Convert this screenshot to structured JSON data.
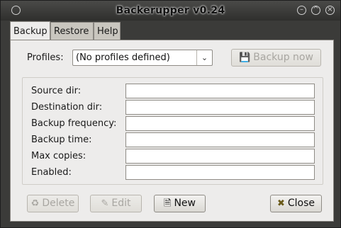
{
  "window": {
    "title": "Backerupper v0.24"
  },
  "tabs": [
    {
      "label": "Backup",
      "active": true
    },
    {
      "label": "Restore",
      "active": false
    },
    {
      "label": "Help",
      "active": false
    }
  ],
  "profiles": {
    "label": "Profiles:",
    "selected": "(No profiles defined)",
    "backup_now_label": "Backup now"
  },
  "fields": [
    {
      "label": "Source dir:",
      "value": ""
    },
    {
      "label": "Destination dir:",
      "value": ""
    },
    {
      "label": "Backup frequency:",
      "value": ""
    },
    {
      "label": "Backup time:",
      "value": ""
    },
    {
      "label": "Max copies:",
      "value": ""
    },
    {
      "label": "Enabled:",
      "value": ""
    }
  ],
  "buttons": {
    "delete_label": "Delete",
    "edit_label": "Edit",
    "new_label": "New",
    "close_label": "Close"
  },
  "icons": {
    "window_menu": "circle-icon",
    "minimize": "minimize-icon",
    "maximize": "maximize-icon",
    "close": "close-icon",
    "save": "floppy-disk-icon",
    "delete": "trash-icon",
    "edit": "edit-icon",
    "new": "new-document-icon",
    "close_button": "close-icon"
  }
}
